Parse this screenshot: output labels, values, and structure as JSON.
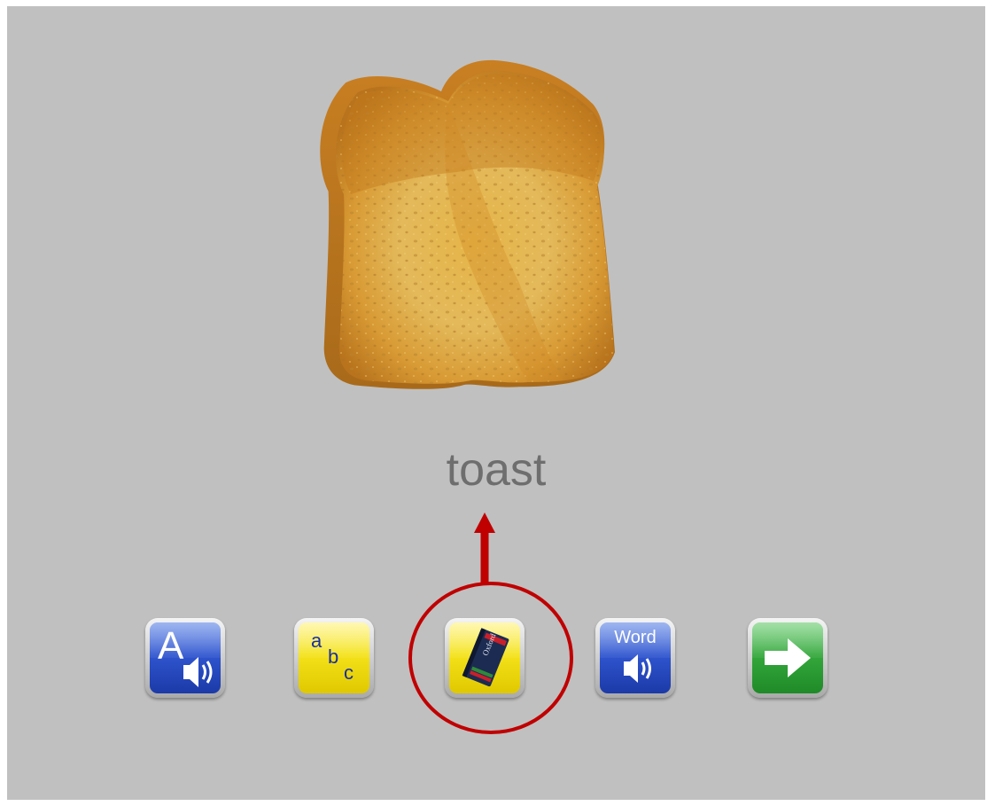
{
  "lesson": {
    "word": "toast",
    "picture": "toast-slice-image"
  },
  "toolbar": {
    "buttons": [
      {
        "id": "say-letters",
        "icon": "letter-a-speaker-icon",
        "glyph": "A",
        "color": "#2f55cf"
      },
      {
        "id": "spell",
        "icon": "abc-letters-icon",
        "letters": [
          "a",
          "b",
          "c"
        ],
        "color": "#f4e21a"
      },
      {
        "id": "dictionary",
        "icon": "oxford-dictionary-book-icon",
        "book_title": "Oxford",
        "book_subtitle": "Dictionary",
        "color": "#f4e21a",
        "highlighted": true
      },
      {
        "id": "say-word",
        "icon": "word-speaker-icon",
        "label": "Word",
        "color": "#2f55cf"
      },
      {
        "id": "next",
        "icon": "right-arrow-icon",
        "color": "#34a83c"
      }
    ]
  },
  "annotation": {
    "color": "#c00000",
    "circle_target": "dictionary",
    "arrow_points_to": "word"
  }
}
